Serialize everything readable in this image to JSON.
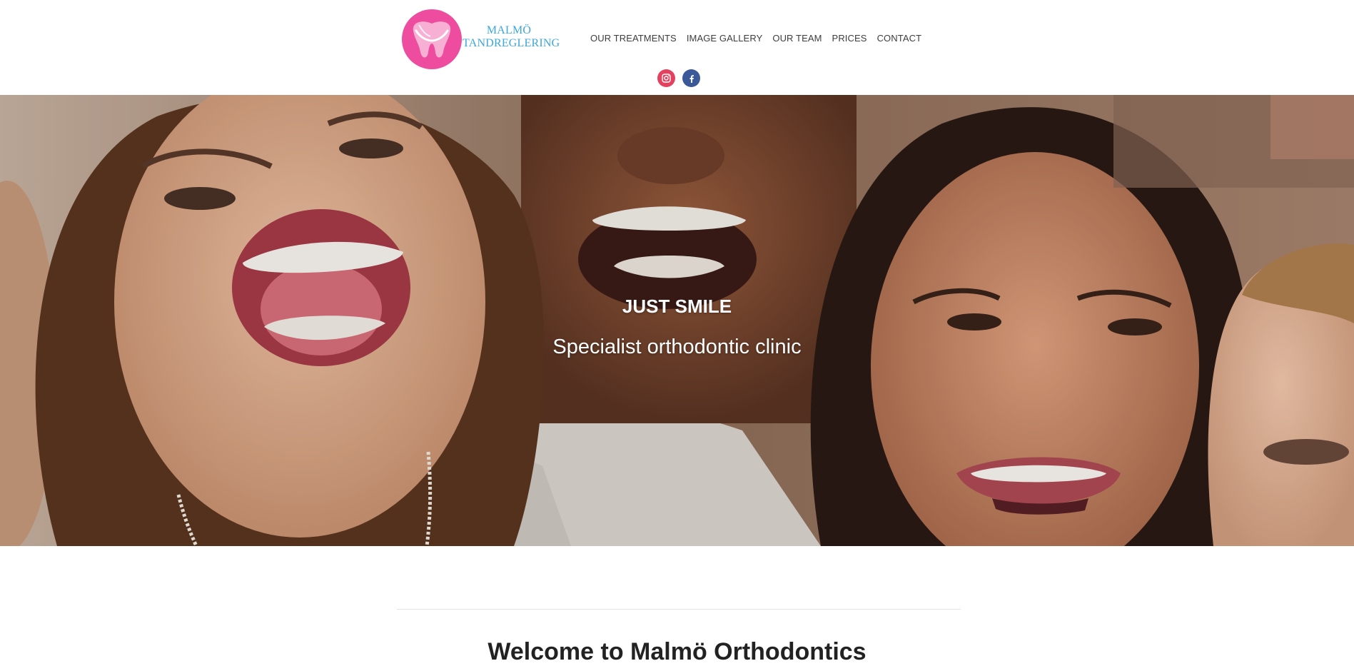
{
  "brand": {
    "logo_line1": "MALMÖ",
    "logo_line2": "TANDREGLERING",
    "pink": "#ee4c9e",
    "blue": "#3aa7d9"
  },
  "nav": {
    "items": [
      {
        "label": "OUR TREATMENTS"
      },
      {
        "label": "IMAGE GALLERY"
      },
      {
        "label": "OUR TEAM"
      },
      {
        "label": "PRICES"
      },
      {
        "label": "CONTACT"
      }
    ]
  },
  "social": {
    "instagram_icon": "instagram-icon",
    "facebook_icon": "facebook-icon",
    "instagram_color": "#e4405f",
    "facebook_color": "#3b5998"
  },
  "hero": {
    "title": "JUST SMILE",
    "subtitle": "Specialist orthodontic clinic"
  },
  "main": {
    "welcome_heading": "Welcome to Malmö Orthodontics"
  }
}
